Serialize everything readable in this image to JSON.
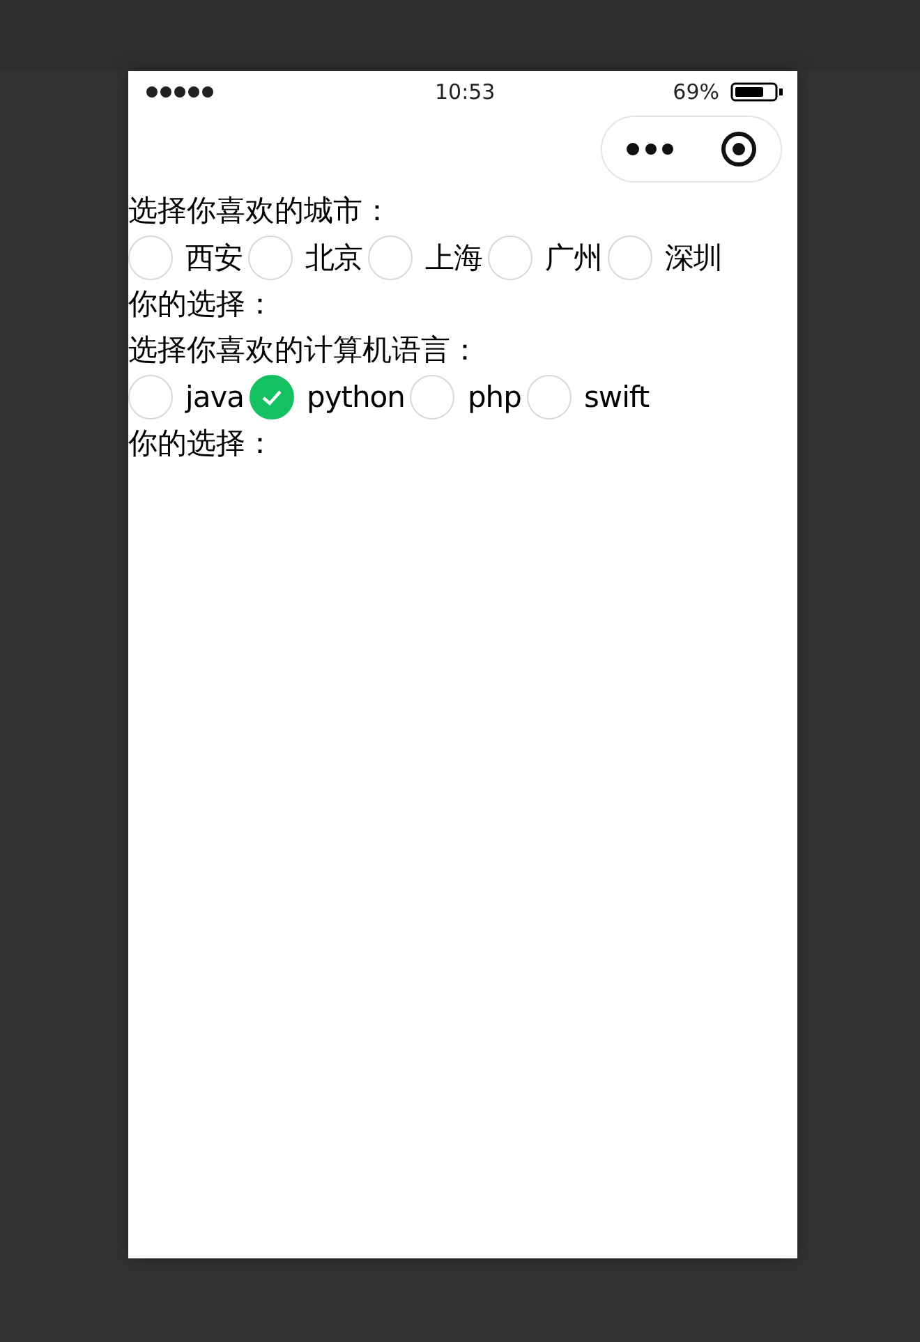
{
  "status_bar": {
    "time": "10:53",
    "battery": "69%"
  },
  "groups": [
    {
      "prompt": "选择你喜欢的城市：",
      "options": [
        {
          "label": "西安",
          "selected": false
        },
        {
          "label": "北京",
          "selected": false
        },
        {
          "label": "上海",
          "selected": false
        },
        {
          "label": "广州",
          "selected": false
        },
        {
          "label": "深圳",
          "selected": false
        }
      ],
      "result": "你的选择："
    },
    {
      "prompt": "选择你喜欢的计算机语言：",
      "options": [
        {
          "label": "java",
          "selected": false
        },
        {
          "label": "python",
          "selected": true
        },
        {
          "label": "php",
          "selected": false
        },
        {
          "label": "swift",
          "selected": false
        }
      ],
      "result": "你的选择："
    }
  ]
}
